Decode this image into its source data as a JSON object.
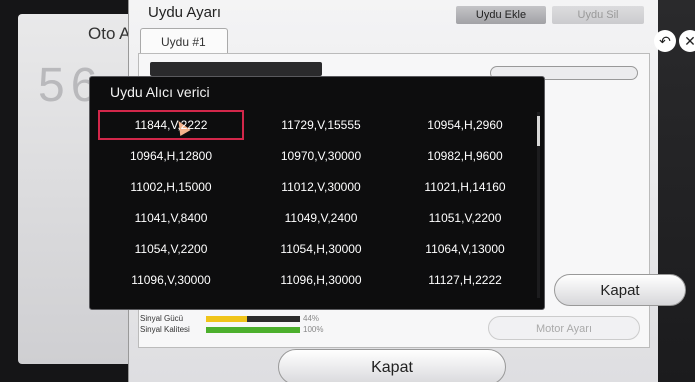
{
  "back_screen": {
    "title": "Oto Ay",
    "big_digits": "56"
  },
  "dialog": {
    "title": "Uydu Ayarı",
    "add_button": "Uydu Ekle",
    "delete_button": "Uydu Sil",
    "tab": "Uydu #1"
  },
  "signal": {
    "strength_label": "Sinyal Gücü",
    "strength_value": "44%",
    "strength_level": 0.44,
    "quality_label": "Sinyal Kalitesi",
    "quality_value": "100%",
    "quality_level": 1.0,
    "strength_color": "#f0c419",
    "quality_color": "#4caf2c"
  },
  "motor_button": "Motor Ayarı",
  "close_main": "Kapat",
  "close_side": "Kapat",
  "popup": {
    "title": "Uydu Alıcı verici",
    "transponders": [
      [
        "11844,V,2222",
        "11729,V,15555",
        "10954,H,2960"
      ],
      [
        "10964,H,12800",
        "10970,V,30000",
        "10982,H,9600"
      ],
      [
        "11002,H,15000",
        "11012,V,30000",
        "11021,H,14160"
      ],
      [
        "11041,V,8400",
        "11049,V,2400",
        "11051,V,2200"
      ],
      [
        "11054,V,2200",
        "11054,H,30000",
        "11064,V,13000"
      ],
      [
        "11096,V,30000",
        "11096,H,30000",
        "11127,H,2222"
      ]
    ],
    "selected": "11844,V,2222",
    "accent": "#d2274a"
  },
  "edge_icons": [
    "back-icon",
    "close-icon"
  ]
}
